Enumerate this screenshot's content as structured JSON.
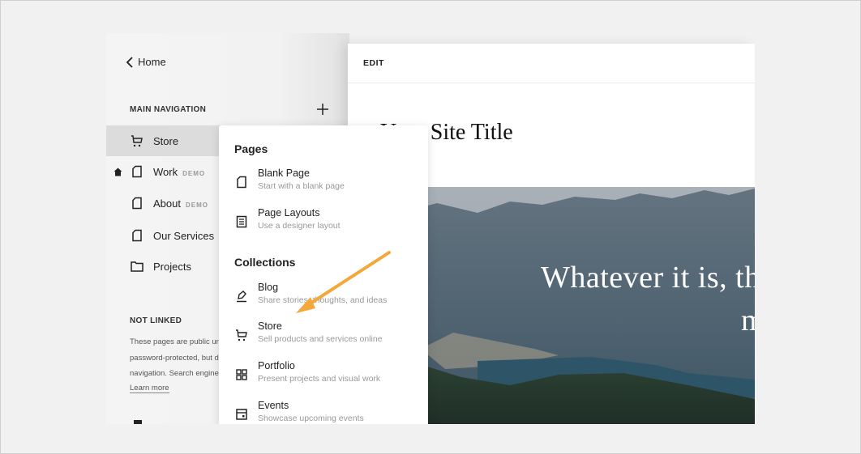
{
  "sidebar": {
    "back_label": "Home",
    "main_nav_label": "MAIN NAVIGATION",
    "items": [
      {
        "label": "Store",
        "badge": "",
        "icon": "cart-icon",
        "active": true,
        "home": false
      },
      {
        "label": "Work",
        "badge": "DEMO",
        "icon": "page-icon",
        "active": false,
        "home": true
      },
      {
        "label": "About",
        "badge": "DEMO",
        "icon": "page-icon",
        "active": false,
        "home": false
      },
      {
        "label": "Our Services",
        "badge": "",
        "icon": "page-icon",
        "active": false,
        "home": false
      },
      {
        "label": "Projects",
        "badge": "",
        "icon": "folder-icon",
        "active": false,
        "home": false
      }
    ],
    "not_linked_label": "NOT LINKED",
    "not_linked_text": [
      "These pages are public unless",
      "password-protected, but don't appear in",
      "navigation. Search engines can also"
    ],
    "learn_more": "Learn more"
  },
  "editor": {
    "header": "EDIT",
    "site_title": "Your Site Title",
    "hero_line1": "Whatever it is, the",
    "hero_line2": "m"
  },
  "menu": {
    "pages_heading": "Pages",
    "collections_heading": "Collections",
    "pages": [
      {
        "title": "Blank Page",
        "desc": "Start with a blank page",
        "icon": "blank-page-icon"
      },
      {
        "title": "Page Layouts",
        "desc": "Use a designer layout",
        "icon": "layout-icon"
      }
    ],
    "collections": [
      {
        "title": "Blog",
        "desc": "Share stories, thoughts, and ideas",
        "icon": "blog-pen-icon"
      },
      {
        "title": "Store",
        "desc": "Sell products and services online",
        "icon": "cart-icon"
      },
      {
        "title": "Portfolio",
        "desc": "Present projects and visual work",
        "icon": "grid-icon"
      },
      {
        "title": "Events",
        "desc": "Showcase upcoming events",
        "icon": "calendar-icon"
      }
    ]
  },
  "annotation": {
    "arrow_color": "#f5a83a"
  }
}
